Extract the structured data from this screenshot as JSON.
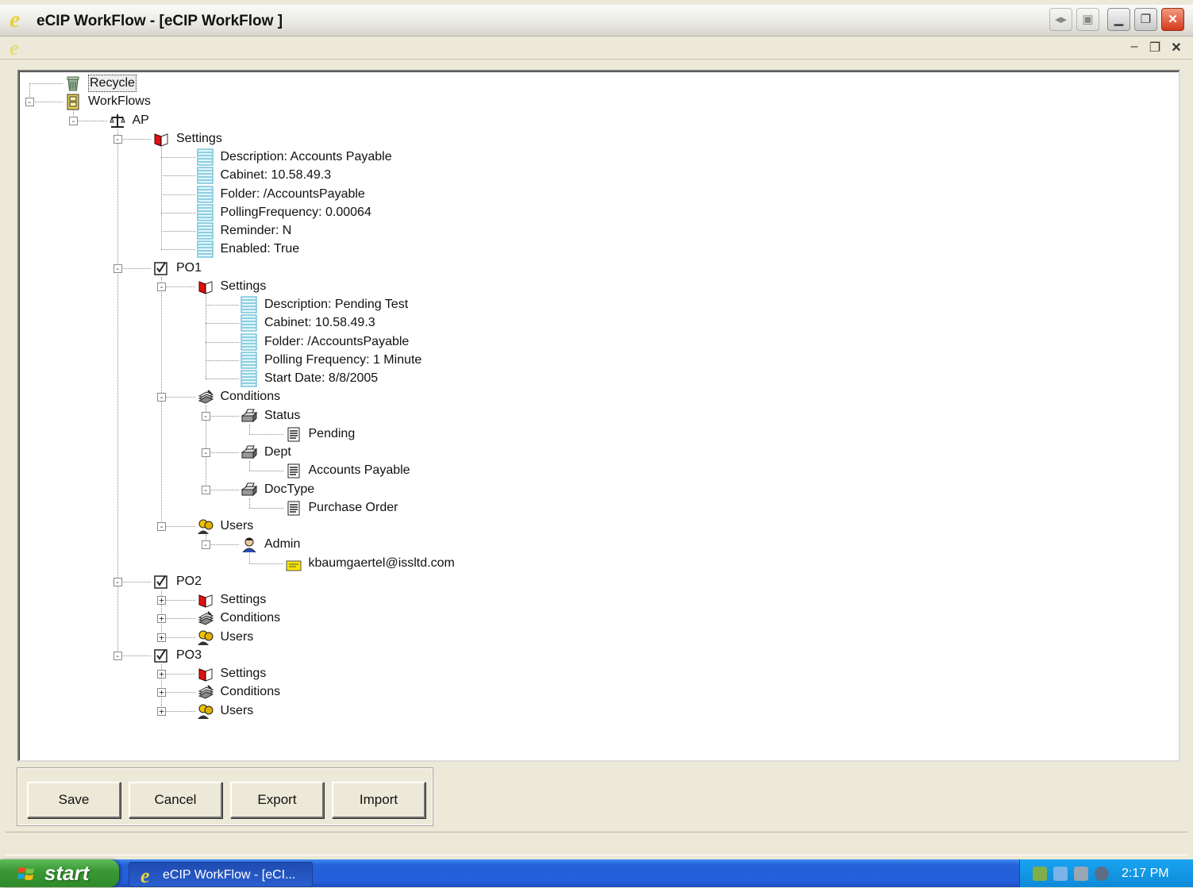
{
  "window": {
    "title": "eCIP WorkFlow - [eCIP WorkFlow ]",
    "app_glyph": "e",
    "controls": [
      "restore-back-icon",
      "tile-icon",
      "minimize-icon",
      "maximize-icon",
      "close-icon"
    ],
    "mdi_controls": [
      "minimize-icon",
      "restore-icon",
      "close-icon"
    ]
  },
  "tree": {
    "nodes": [
      {
        "id": "recycle",
        "label": "Recycle",
        "icon": "recycle-bin-icon",
        "depth": 0,
        "row": 0,
        "selected": true
      },
      {
        "id": "workflows",
        "label": "WorkFlows",
        "icon": "workflows-cabinet-icon",
        "depth": 0,
        "row": 1,
        "expander": "-"
      },
      {
        "id": "ap",
        "label": "AP",
        "icon": "scales-icon",
        "depth": 1,
        "row": 2,
        "expander": "-"
      },
      {
        "id": "ap-settings",
        "label": "Settings",
        "icon": "settings-book-icon",
        "depth": 2,
        "row": 3,
        "expander": "-"
      },
      {
        "id": "ap-desc",
        "label": "Description: Accounts Payable",
        "icon": "property-icon",
        "depth": 3,
        "row": 4
      },
      {
        "id": "ap-cabinet",
        "label": "Cabinet: 10.58.49.3",
        "icon": "property-icon",
        "depth": 3,
        "row": 5
      },
      {
        "id": "ap-folder",
        "label": "Folder: /AccountsPayable",
        "icon": "property-icon",
        "depth": 3,
        "row": 6
      },
      {
        "id": "ap-polling",
        "label": "PollingFrequency: 0.00064",
        "icon": "property-icon",
        "depth": 3,
        "row": 7
      },
      {
        "id": "ap-reminder",
        "label": "Reminder: N",
        "icon": "property-icon",
        "depth": 3,
        "row": 8
      },
      {
        "id": "ap-enabled",
        "label": "Enabled: True",
        "icon": "property-icon",
        "depth": 3,
        "row": 9
      },
      {
        "id": "po1",
        "label": "PO1",
        "icon": "checkbox-task-icon",
        "depth": 2,
        "row": 10,
        "expander": "-"
      },
      {
        "id": "po1-settings",
        "label": "Settings",
        "icon": "settings-book-icon",
        "depth": 3,
        "row": 11,
        "expander": "-"
      },
      {
        "id": "po1-desc",
        "label": "Description: Pending Test",
        "icon": "property-icon",
        "depth": 4,
        "row": 12
      },
      {
        "id": "po1-cabinet",
        "label": "Cabinet: 10.58.49.3",
        "icon": "property-icon",
        "depth": 4,
        "row": 13
      },
      {
        "id": "po1-folder",
        "label": "Folder: /AccountsPayable",
        "icon": "property-icon",
        "depth": 4,
        "row": 14
      },
      {
        "id": "po1-polling",
        "label": "Polling Frequency: 1 Minute",
        "icon": "property-icon",
        "depth": 4,
        "row": 15
      },
      {
        "id": "po1-start",
        "label": "Start Date: 8/8/2005",
        "icon": "property-icon",
        "depth": 4,
        "row": 16
      },
      {
        "id": "po1-conditions",
        "label": "Conditions",
        "icon": "conditions-stack-icon",
        "depth": 3,
        "row": 17,
        "expander": "-"
      },
      {
        "id": "po1-status",
        "label": "Status",
        "icon": "printer-icon",
        "depth": 4,
        "row": 18,
        "expander": "-"
      },
      {
        "id": "po1-pending",
        "label": "Pending",
        "icon": "document-lines-icon",
        "depth": 5,
        "row": 19
      },
      {
        "id": "po1-dept",
        "label": "Dept",
        "icon": "printer-icon",
        "depth": 4,
        "row": 20,
        "expander": "-"
      },
      {
        "id": "po1-ap-value",
        "label": "Accounts Payable",
        "icon": "document-lines-icon",
        "depth": 5,
        "row": 21
      },
      {
        "id": "po1-doctype",
        "label": "DocType",
        "icon": "printer-icon",
        "depth": 4,
        "row": 22,
        "expander": "-"
      },
      {
        "id": "po1-po-value",
        "label": "Purchase Order",
        "icon": "document-lines-icon",
        "depth": 5,
        "row": 23
      },
      {
        "id": "po1-users",
        "label": "Users",
        "icon": "users-group-icon",
        "depth": 3,
        "row": 24,
        "expander": "-"
      },
      {
        "id": "po1-admin",
        "label": "Admin",
        "icon": "user-icon",
        "depth": 4,
        "row": 25,
        "expander": "-"
      },
      {
        "id": "po1-email",
        "label": "kbaumgaertel@issltd.com",
        "icon": "email-note-icon",
        "depth": 5,
        "row": 26
      },
      {
        "id": "po2",
        "label": "PO2",
        "icon": "checkbox-task-icon",
        "depth": 2,
        "row": 27,
        "expander": "-"
      },
      {
        "id": "po2-settings",
        "label": "Settings",
        "icon": "settings-book-icon",
        "depth": 3,
        "row": 28,
        "expander": "+"
      },
      {
        "id": "po2-conditions",
        "label": "Conditions",
        "icon": "conditions-stack-icon",
        "depth": 3,
        "row": 29,
        "expander": "+"
      },
      {
        "id": "po2-users",
        "label": "Users",
        "icon": "users-group-icon",
        "depth": 3,
        "row": 30,
        "expander": "+"
      },
      {
        "id": "po3",
        "label": "PO3",
        "icon": "checkbox-task-icon",
        "depth": 2,
        "row": 31,
        "expander": "-"
      },
      {
        "id": "po3-settings",
        "label": "Settings",
        "icon": "settings-book-icon",
        "depth": 3,
        "row": 32,
        "expander": "+"
      },
      {
        "id": "po3-conditions",
        "label": "Conditions",
        "icon": "conditions-stack-icon",
        "depth": 3,
        "row": 33,
        "expander": "+"
      },
      {
        "id": "po3-users",
        "label": "Users",
        "icon": "users-group-icon",
        "depth": 3,
        "row": 34,
        "expander": "+"
      }
    ]
  },
  "buttons": {
    "save": "Save",
    "cancel": "Cancel",
    "export": "Export",
    "import": "Import"
  },
  "taskbar": {
    "start_label": "start",
    "task_label": "eCIP WorkFlow - [eCI...",
    "clock": "2:17 PM",
    "tray_icons": [
      "network-icon",
      "display-icon",
      "volume-icon",
      "shield-icon"
    ]
  },
  "colors": {
    "taskbar_blue": "#245edb",
    "start_green": "#3a9a34",
    "tray_blue": "#0e8ad8",
    "close_red": "#d5391a",
    "app_glyph_yellow": "#e8d33a"
  }
}
